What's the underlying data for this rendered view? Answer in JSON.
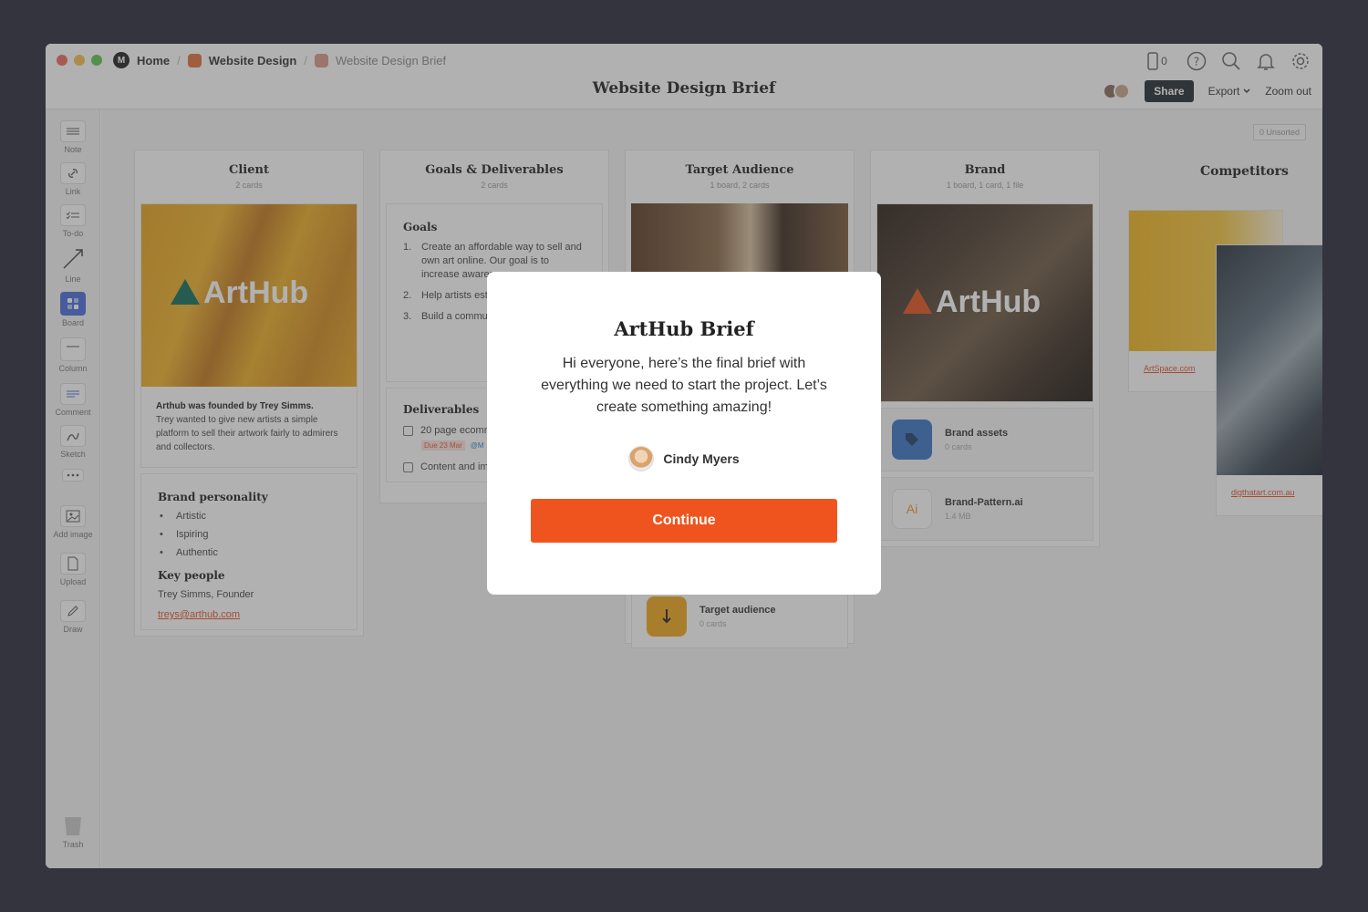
{
  "breadcrumbs": [
    {
      "label": "Home",
      "color": "#222222"
    },
    {
      "label": "Website Design",
      "color": "#e0703a"
    },
    {
      "label": "Website Design Brief",
      "color": "#d99a88"
    }
  ],
  "page_title": "Website Design Brief",
  "topbar": {
    "device_count": "0",
    "share_label": "Share",
    "export_label": "Export",
    "zoom_label": "Zoom out"
  },
  "sidebar": {
    "tools": [
      {
        "label": "Note",
        "icon": "note-icon"
      },
      {
        "label": "Link",
        "icon": "link-icon"
      },
      {
        "label": "To-do",
        "icon": "todo-icon"
      },
      {
        "label": "Line",
        "icon": "line-icon"
      },
      {
        "label": "Board",
        "icon": "board-icon"
      },
      {
        "label": "Column",
        "icon": "column-icon"
      },
      {
        "label": "Comment",
        "icon": "comment-icon"
      },
      {
        "label": "Sketch",
        "icon": "sketch-icon"
      },
      {
        "label": "Add image",
        "icon": "add-image-icon"
      },
      {
        "label": "Upload",
        "icon": "upload-icon"
      },
      {
        "label": "Draw",
        "icon": "draw-icon"
      }
    ],
    "trash_label": "Trash"
  },
  "board": {
    "unsorted": "0 Unsorted",
    "columns": {
      "client": {
        "title": "Client",
        "sub": "2 cards",
        "logo_text": "ArtHub",
        "founded_bold": "Arthub was founded by Trey Simms.",
        "founded_text": "Trey wanted to give new artists a simple platform to sell their artwork fairly to admirers and collectors.",
        "personality_title": "Brand personality",
        "personality": [
          "Artistic",
          "Ispiring",
          "Authentic"
        ],
        "key_people_title": "Key people",
        "key_person": "Trey Simms, Founder",
        "email": "treys@arthub.com"
      },
      "goals": {
        "title": "Goals & Deliverables",
        "sub": "2 cards",
        "goals_title": "Goals",
        "goals": [
          {
            "n": "1.",
            "text": "Create an affordable way to sell and own art online. Our goal is to increase awarer"
          },
          {
            "n": "2.",
            "text": "Help artists est themselves onl"
          },
          {
            "n": "3.",
            "text": "Build a commu follow artists, b art"
          }
        ],
        "deliverables_title": "Deliverables",
        "deliverables": [
          "20 page ecomm",
          "Content and im"
        ],
        "due": "Due 23 Mar",
        "mention": "@M"
      },
      "audience": {
        "title": "Target Audience",
        "sub": "1 board, 2 cards",
        "board_name": "Target audience",
        "board_meta": "0 cards"
      },
      "brand": {
        "title": "Brand",
        "sub": "1 board, 1 card, 1 file",
        "logo_text": "ArtHub",
        "assets_name": "Brand assets",
        "assets_meta": "0 cards",
        "file_ext": "Ai",
        "file_name": "Brand-Pattern.ai",
        "file_meta": "1.4 MB"
      }
    },
    "competitors": {
      "title": "Competitors",
      "links": [
        "ArtSpace.com",
        "digthatart.com.au"
      ]
    }
  },
  "modal": {
    "title": "ArtHub Brief",
    "body": "Hi everyone, here’s the final brief with everything we need to start the project. Let’s create something amazing!",
    "author": "Cindy Myers",
    "button": "Continue",
    "button_color": "#f0541e"
  }
}
